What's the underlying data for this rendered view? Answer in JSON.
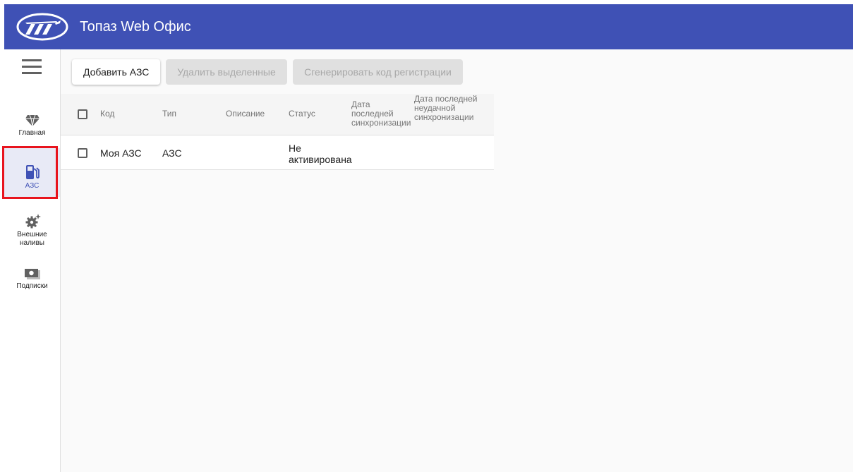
{
  "app": {
    "title": "Топаз Web Офис",
    "accent_color": "#3f51b5",
    "logo_icon": "topaz-logo"
  },
  "sidebar": {
    "menu_icon": "hamburger-menu-icon",
    "items": [
      {
        "label": "Главная",
        "icon": "diamond-icon",
        "active": false
      },
      {
        "label": "АЗС",
        "icon": "gas-station-icon",
        "active": true
      },
      {
        "label": "Внешние наливы",
        "icon": "gear-sparkle-icon",
        "active": false
      },
      {
        "label": "Подписки",
        "icon": "money-icon",
        "active": false
      }
    ]
  },
  "toolbar": {
    "add_label": "Добавить АЗС",
    "delete_label": "Удалить выделенные",
    "generate_label": "Сгенерировать код регистрации"
  },
  "table": {
    "columns": [
      "Код",
      "Тип",
      "Описание",
      "Статус",
      "Дата последней синхронизации",
      "Дата последней неудачной синхронизации"
    ],
    "rows": [
      {
        "code": "Моя АЗС",
        "type": "АЗС",
        "description": "",
        "status": "Не активирована",
        "last_sync": "",
        "last_failed_sync": ""
      }
    ]
  }
}
